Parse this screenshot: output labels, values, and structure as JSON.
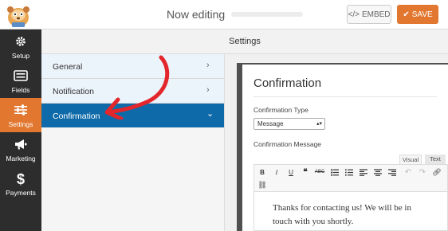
{
  "header": {
    "title": "Now editing",
    "embed_label": "EMBED",
    "embed_icon": "</>",
    "save_label": "SAVE",
    "save_icon": "✔"
  },
  "sidebar": {
    "items": [
      {
        "label": "Setup",
        "icon": "gear-icon"
      },
      {
        "label": "Fields",
        "icon": "fields-icon"
      },
      {
        "label": "Settings",
        "icon": "sliders-icon"
      },
      {
        "label": "Marketing",
        "icon": "megaphone-icon"
      },
      {
        "label": "Payments",
        "icon": "dollar-icon"
      }
    ]
  },
  "settings": {
    "title": "Settings",
    "menu": [
      {
        "label": "General",
        "chevron": "›"
      },
      {
        "label": "Notification",
        "chevron": "›"
      },
      {
        "label": "Confirmation",
        "chevron": "⌄"
      }
    ]
  },
  "confirmation": {
    "title": "Confirmation",
    "type_label": "Confirmation Type",
    "type_value": "Message",
    "message_label": "Confirmation Message",
    "tab_visual": "Visual",
    "tab_text": "Text",
    "message_text": "Thanks for contacting us! We will be in touch with you shortly."
  },
  "colors": {
    "accent_orange": "#e27730",
    "active_blue": "#0e6aa8",
    "rail_dark": "#2d2d2d",
    "annotation_red": "#e3262b"
  }
}
